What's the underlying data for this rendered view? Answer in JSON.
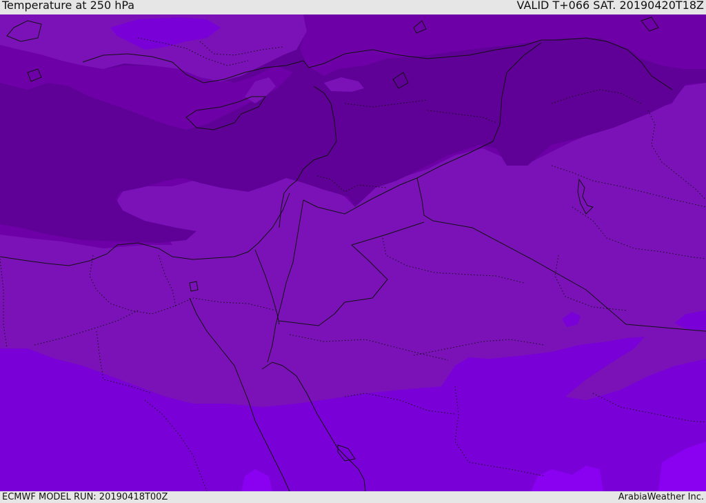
{
  "header": {
    "title": "Temperature at 250 hPa",
    "valid": "VALID T+066 SAT. 20190420T18Z"
  },
  "footer": {
    "model_run": "ECMWF MODEL RUN: 20190418T00Z",
    "brand": "ArabiaWeather Inc."
  },
  "map": {
    "colors": {
      "coldest_band": "#5f0096",
      "cold_band": "#6e00a8",
      "mid_band": "#7a12b8",
      "warm_band": "#7a00d8",
      "warmest_band": "#8a00f0",
      "boundary_line": "#111111"
    }
  }
}
